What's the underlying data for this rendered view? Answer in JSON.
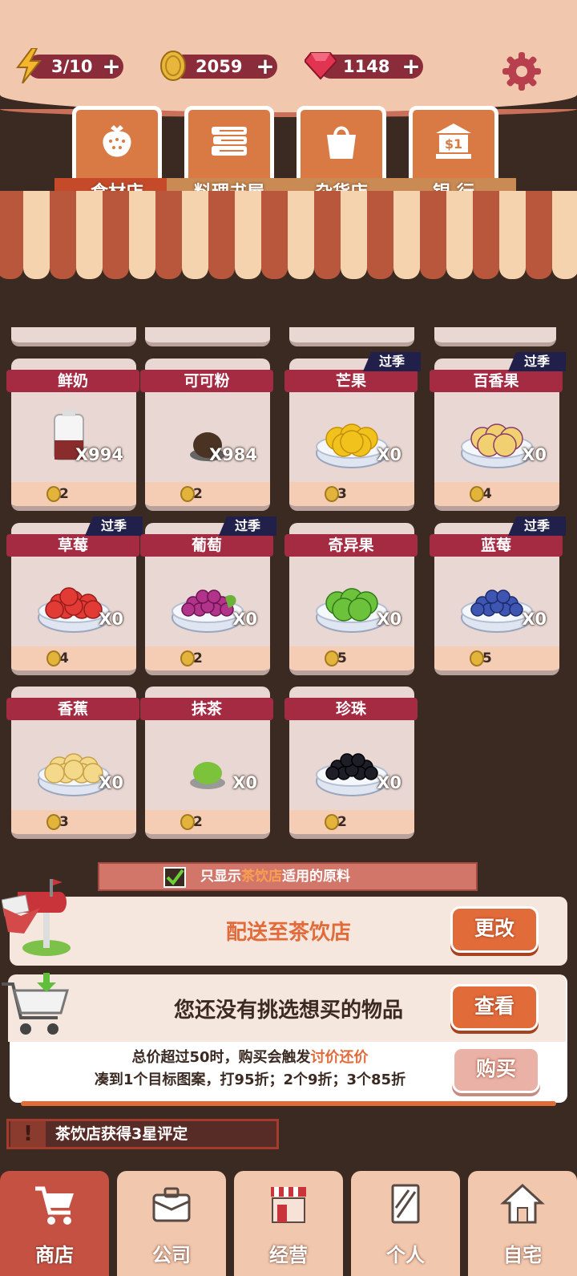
{
  "resources": {
    "energy": {
      "value": "3/10",
      "icon": "lightning-icon"
    },
    "coins": {
      "value": "2059",
      "icon": "coin-icon"
    },
    "gems": {
      "value": "1148",
      "icon": "ruby-icon"
    },
    "plus": "+"
  },
  "tabs": [
    {
      "label": "食材店",
      "icon": "strawberry-icon",
      "active": true
    },
    {
      "label": "料理书屋",
      "icon": "books-icon"
    },
    {
      "label": "杂货店",
      "icon": "shopping-bag-icon"
    },
    {
      "label": "银 行",
      "icon": "bank-icon"
    }
  ],
  "items": [
    {
      "name": "鲜奶",
      "qty": "X994",
      "price": "2",
      "season": ""
    },
    {
      "name": "可可粉",
      "qty": "X984",
      "price": "2",
      "season": ""
    },
    {
      "name": "芒果",
      "qty": "X0",
      "price": "3",
      "season": "过季"
    },
    {
      "name": "百香果",
      "qty": "X0",
      "price": "4",
      "season": "过季"
    },
    {
      "name": "草莓",
      "qty": "X0",
      "price": "4",
      "season": "过季"
    },
    {
      "name": "葡萄",
      "qty": "X0",
      "price": "2",
      "season": "过季"
    },
    {
      "name": "奇异果",
      "qty": "X0",
      "price": "5",
      "season": ""
    },
    {
      "name": "蓝莓",
      "qty": "X0",
      "price": "5",
      "season": "过季"
    },
    {
      "name": "香蕉",
      "qty": "X0",
      "price": "3",
      "season": ""
    },
    {
      "name": "抹茶",
      "qty": "X0",
      "price": "2",
      "season": ""
    },
    {
      "name": "珍珠",
      "qty": "X0",
      "price": "2",
      "season": ""
    }
  ],
  "filter": {
    "prefix": "只显示",
    "highlight": "茶饮店",
    "suffix": "适用的原料",
    "checked": true
  },
  "delivery": {
    "text": "配送至茶饮店",
    "button": "更改"
  },
  "cart": {
    "text": "您还没有挑选想买的物品",
    "button": "查看"
  },
  "purchase": {
    "line1_prefix": "总价超过50时，购买会触发",
    "line1_highlight": "讨价还价",
    "line2": "凑到1个目标图案，打95折；2个9折；3个85折",
    "button": "购买"
  },
  "notice": {
    "text": "茶饮店获得3星评定"
  },
  "nav": [
    {
      "label": "商店",
      "icon": "cart-icon",
      "active": true
    },
    {
      "label": "公司",
      "icon": "briefcase-icon"
    },
    {
      "label": "经营",
      "icon": "storefront-icon"
    },
    {
      "label": "个人",
      "icon": "notebook-icon"
    },
    {
      "label": "自宅",
      "icon": "house-icon"
    }
  ],
  "colors": {
    "accent": "#a52b43",
    "button": "#e26b3a",
    "background": "#3b2a22"
  }
}
